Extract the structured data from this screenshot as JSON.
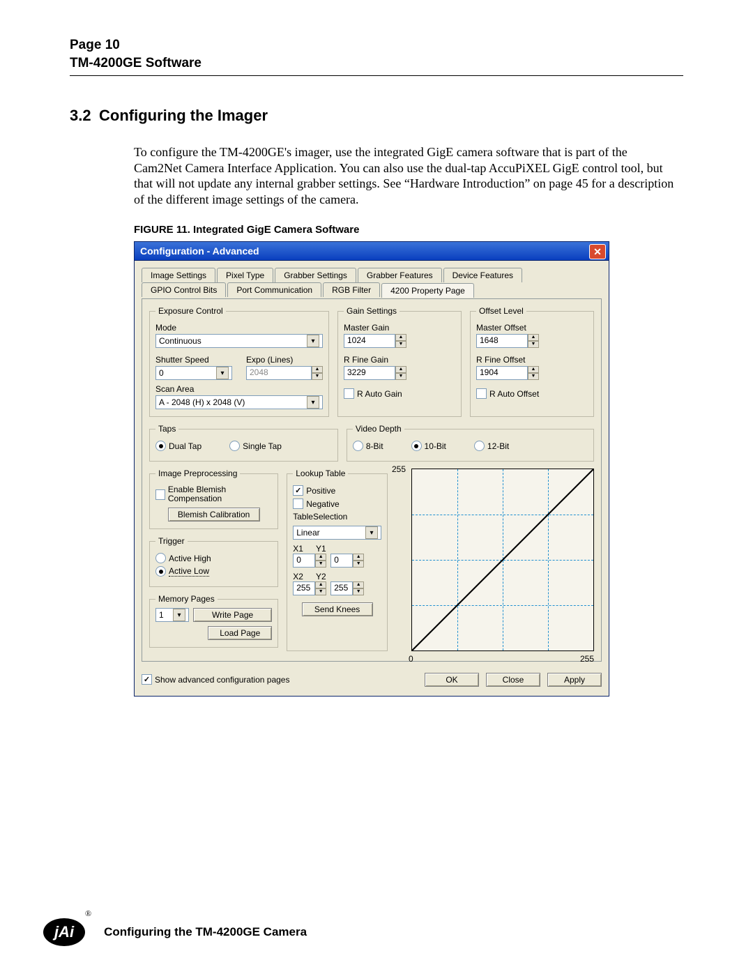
{
  "header": {
    "page_label": "Page 10",
    "subtitle": "TM-4200GE Software"
  },
  "section": {
    "number": "3.2",
    "title": "Configuring the Imager"
  },
  "body_text": "To configure the TM-4200GE's imager, use the integrated GigE camera software that is part of the Cam2Net Camera Interface Application. You can also use the dual-tap AccuPiXEL GigE control tool, but that will not update any internal grabber settings.  See “Hardware Introduction” on page 45 for a description of the different image settings of the camera.",
  "figure_caption": "FIGURE 11.  Integrated GigE Camera Software",
  "dialog": {
    "title": "Configuration - Advanced",
    "tabs_row1": [
      "Image Settings",
      "Pixel Type",
      "Grabber Settings",
      "Grabber Features",
      "Device Features"
    ],
    "tabs_row2": [
      "GPIO Control Bits",
      "Port Communication",
      "RGB Filter",
      "4200 Property Page"
    ],
    "exposure": {
      "legend": "Exposure Control",
      "mode_label": "Mode",
      "mode_value": "Continuous",
      "shutter_label": "Shutter Speed",
      "expo_label": "Expo (Lines)",
      "shutter_value": "0",
      "expo_value": "2048",
      "scan_label": "Scan Area",
      "scan_value": "A - 2048 (H) x 2048 (V)"
    },
    "gain": {
      "legend": "Gain Settings",
      "master_label": "Master Gain",
      "master_value": "1024",
      "rfine_label": "R Fine Gain",
      "rfine_value": "3229",
      "auto_label": "R Auto Gain"
    },
    "offset": {
      "legend": "Offset Level",
      "master_label": "Master Offset",
      "master_value": "1648",
      "rfine_label": "R Fine Offset",
      "rfine_value": "1904",
      "auto_label": "R Auto Offset"
    },
    "taps": {
      "legend": "Taps",
      "dual": "Dual Tap",
      "single": "Single Tap"
    },
    "video": {
      "legend": "Video Depth",
      "b8": "8-Bit",
      "b10": "10-Bit",
      "b12": "12-Bit"
    },
    "preproc": {
      "legend": "Image Preprocessing",
      "blemish_chk": "Enable Blemish Compensation",
      "blemish_btn": "Blemish Calibration"
    },
    "trigger": {
      "legend": "Trigger",
      "high": "Active High",
      "low": "Active Low"
    },
    "memory": {
      "legend": "Memory Pages",
      "value": "1",
      "write": "Write Page",
      "load": "Load Page"
    },
    "lut": {
      "legend": "Lookup Table",
      "positive": "Positive",
      "negative": "Negative",
      "tablesel_label": "TableSelection",
      "tablesel_value": "Linear",
      "x1": "X1",
      "y1": "Y1",
      "x2": "X2",
      "y2": "Y2",
      "x1v": "0",
      "y1v": "0",
      "x2v": "255",
      "y2v": "255",
      "send": "Send Knees",
      "axis_max": "255",
      "axis_min": "0"
    },
    "bottom": {
      "show_adv": "Show advanced configuration pages",
      "ok": "OK",
      "close": "Close",
      "apply": "Apply"
    }
  },
  "footer": {
    "logo_text": "jAi",
    "reg": "®",
    "text": "Configuring the TM-4200GE Camera"
  }
}
